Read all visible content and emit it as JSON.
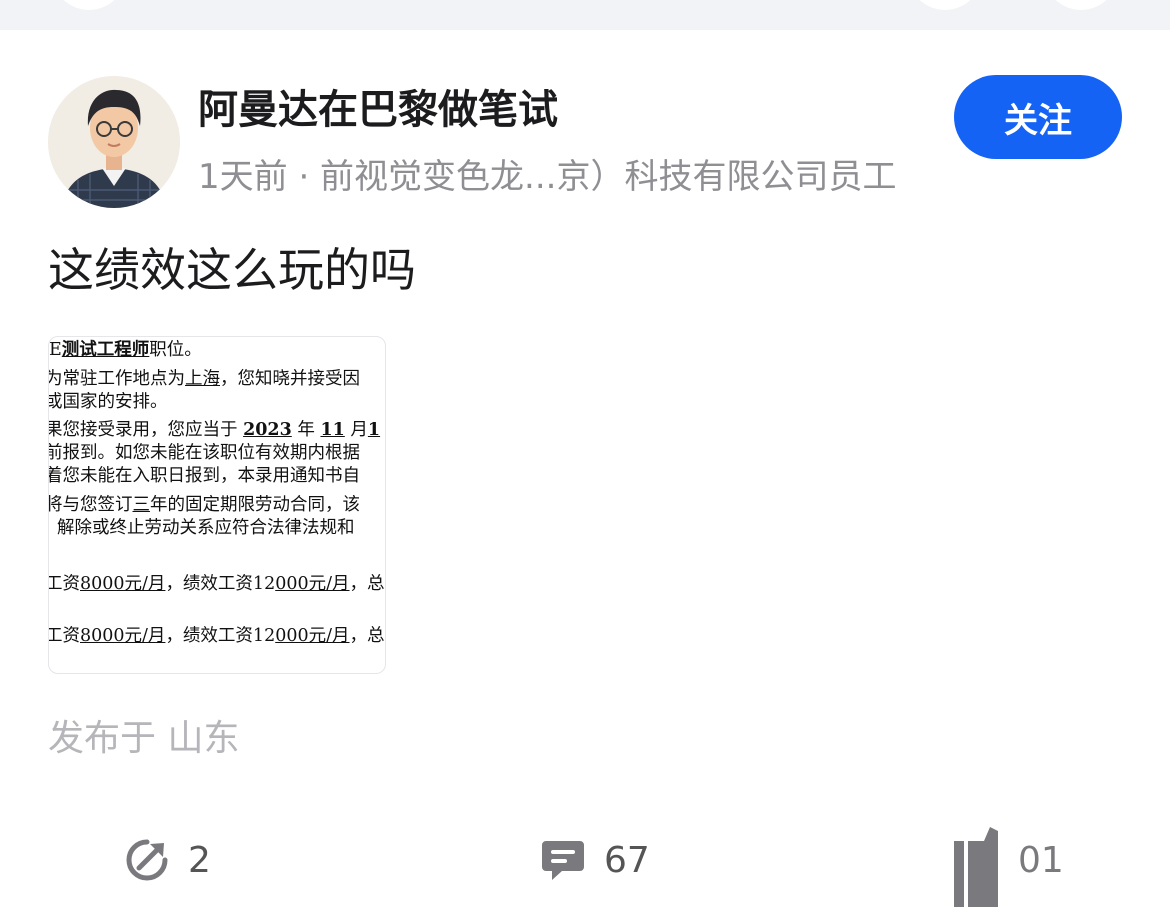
{
  "post": {
    "author": "阿曼达在巴黎做笔试",
    "meta": "1天前 · 前视觉变色龙...京）科技有限公司员工",
    "follow_label": "关注",
    "text": "这绩效这么玩的吗",
    "location": "发布于 山东"
  },
  "document_image": {
    "lines": [
      [
        "E",
        "测试工程师",
        "职位。"
      ],
      [
        "为常驻工作地点为",
        "上海",
        "，您知晓并接受因"
      ],
      [
        "或国家的安排。"
      ],
      [
        "果您接受录用，您应当于",
        "2023",
        "年",
        "11",
        "月",
        "1"
      ],
      [
        "前报到。如您未能在该职位有效期内根据"
      ],
      [
        "着您未能在入职日报到，本录用通知书自"
      ],
      [
        "将与您签订",
        "三",
        "年的固定期限劳动合同，该"
      ],
      [
        "解除或终止劳动关系应符合法律法规和"
      ],
      [
        "工资",
        "8000元/月",
        "，绩效工资12",
        "000元/月",
        "，总"
      ],
      [
        "工资",
        "8000元/月",
        "，绩效工资12",
        "000元/月",
        "，总"
      ]
    ]
  },
  "actions": {
    "share_count": "2",
    "comment_count": "67",
    "like_count": "01"
  },
  "colors": {
    "accent": "#1463f5",
    "secondary_text": "#8e8e93",
    "location_text": "#b5b5ba",
    "icon_gray": "#7a7a7e"
  },
  "icons": {
    "share": "share-arrow-icon",
    "comment": "comment-bubble-icon",
    "like": "thumbs-up-icon"
  }
}
